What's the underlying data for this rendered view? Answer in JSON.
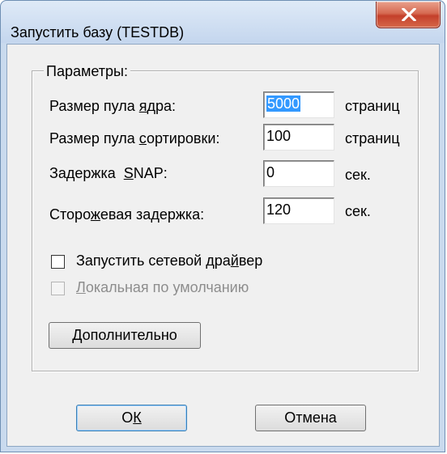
{
  "window": {
    "title": "Запустить базу (TESTDB)"
  },
  "group": {
    "label": "Параметры:"
  },
  "fields": [
    {
      "label_pre": "Размер пула ",
      "label_mn": "я",
      "label_post": "дра:",
      "value": "5000",
      "unit": "страниц"
    },
    {
      "label_pre": "Размер пула ",
      "label_mn": "с",
      "label_post": "ортировки:",
      "value": "100",
      "unit": "страниц"
    },
    {
      "label_pre": "Задержка  ",
      "label_mn": "S",
      "label_post": "NAP:",
      "value": "0",
      "unit": "сек."
    },
    {
      "label_pre": "Сторо",
      "label_mn": "ж",
      "label_post": "евая задержка:",
      "value": "120",
      "unit": "сек."
    }
  ],
  "checkboxes": [
    {
      "pre": "Запустить сетевой дра",
      "mn": "й",
      "post": "вер"
    },
    {
      "pre": "",
      "mn": "Л",
      "post": "окальная по умолчанию"
    }
  ],
  "advanced_button": {
    "pre": "",
    "mn": "Д",
    "post": "ополнительно"
  },
  "ok_button": {
    "pre": "О",
    "mn": "К",
    "post": ""
  },
  "cancel_button": {
    "label": "Отмена"
  },
  "colors": {
    "close_button": "#c4402b",
    "selection": "#3399ff",
    "dialog_bg": "#f0f0f0"
  }
}
